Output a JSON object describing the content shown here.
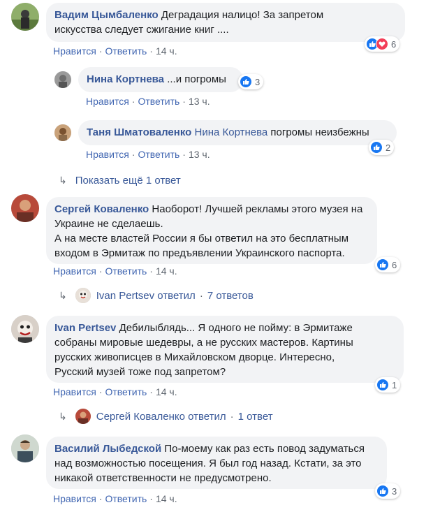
{
  "comments": [
    {
      "name": "Вадим Цымбаленко",
      "text1": "Деградация налицо! За запретом",
      "text2": "искусства следует сжигание книг ....",
      "like": "Нравится",
      "reply": "Ответить",
      "time": "14 ч.",
      "count": "6"
    },
    {
      "name": "Нина Кортнева",
      "text": "...и погромы",
      "like": "Нравится",
      "reply": "Ответить",
      "time": "13 ч.",
      "count": "3"
    },
    {
      "name": "Таня Шматоваленко",
      "mention": "Нина Кортнева",
      "text": "погромы неизбежны",
      "like": "Нравится",
      "reply": "Ответить",
      "time": "13 ч.",
      "count": "2"
    },
    {
      "name": "Сергей Коваленко",
      "text1": "Наоборот! Лучшей рекламы этого музея на",
      "text2": "Украине не сделаешь.",
      "text3": "А на месте властей России я бы ответил на это бесплатным",
      "text4": "входом в Эрмитаж по предъявлении Украинского паспорта.",
      "like": "Нравится",
      "reply": "Ответить",
      "time": "14 ч.",
      "count": "6"
    },
    {
      "name": "Ivan Pertsev",
      "text1": "Дебилыблядь... Я одного не пойму: в Эрмитаже",
      "text2": "собраны мировые шедевры, а не русских мастеров. Картины",
      "text3": "русских живописцев в Михайловском дворце. Интересно,",
      "text4": "Русский музей тоже под запретом?",
      "like": "Нравится",
      "reply": "Ответить",
      "time": "14 ч.",
      "count": "1"
    },
    {
      "name": "Василий Лыбедской",
      "text1": "По-моему как раз есть повод задуматься",
      "text2": "над возможностью посещения. Я был год назад. Кстати, за это",
      "text3": "никакой ответственности не предусмотрено.",
      "like": "Нравится",
      "reply": "Ответить",
      "time": "14 ч.",
      "count": "3"
    }
  ],
  "show_more": "Показать ещё 1 ответ",
  "thread1": {
    "who": "Ivan Pertsev ответил",
    "count": "7 ответов"
  },
  "thread2": {
    "who": "Сергей Коваленко ответил",
    "count": "1 ответ"
  },
  "sep": "·",
  "colors": {
    "link": "#385898",
    "action": "#4267b2",
    "bubble": "#f2f3f5",
    "like": "#1877f2",
    "love": "#f33e58"
  }
}
